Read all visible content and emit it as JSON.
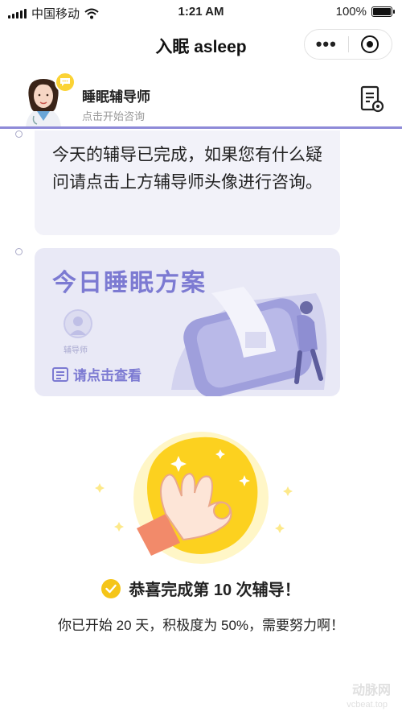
{
  "status_bar": {
    "carrier": "中国移动",
    "time": "1:21 AM",
    "battery": "100%",
    "battery_level": 1.0
  },
  "nav": {
    "title": "入眠 asleep"
  },
  "coach": {
    "name": "睡眠辅导师",
    "subtitle": "点击开始咨询"
  },
  "messages": {
    "completion_text": "今天的辅导已完成，如果您有什么疑问请点击上方辅导师头像进行咨询。"
  },
  "plan_card": {
    "title": "今日睡眠方案",
    "mini_avatar_label": "辅导师",
    "link_label": "请点击查看"
  },
  "congrats": {
    "headline": "恭喜完成第 10 次辅导！",
    "progress": "你已开始 20 天，积极度为 50%，需要努力啊！"
  },
  "watermark": {
    "brand": "动脉网",
    "url": "vcbeat.top"
  },
  "colors": {
    "accent": "#8e8ad8",
    "plan_purple": "#7c7ad2",
    "yellow": "#fbd335",
    "bubble_bg": "#f2f2f9"
  }
}
